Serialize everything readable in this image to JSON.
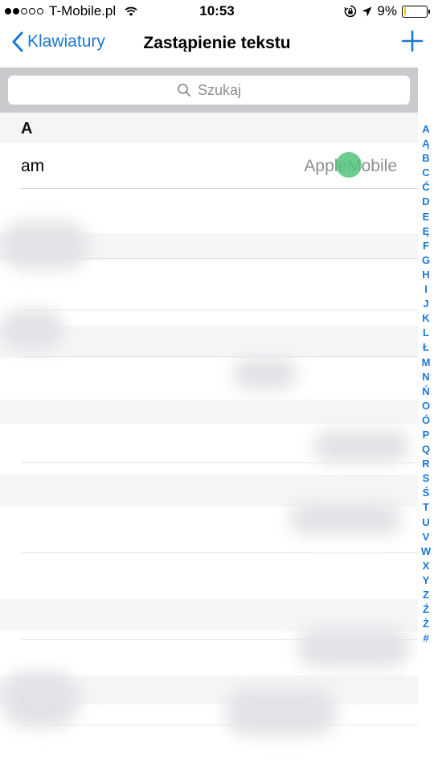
{
  "status_bar": {
    "carrier": "T-Mobile.pl",
    "time": "10:53",
    "battery_percent": "9%",
    "battery_level": 0.09,
    "signal_filled": 2,
    "signal_total": 5,
    "icons": [
      "wifi-icon",
      "rotation-lock-icon",
      "location-icon",
      "battery-icon"
    ]
  },
  "nav": {
    "back_label": "Klawiatury",
    "title": "Zastąpienie tekstu",
    "add_icon": "plus-icon"
  },
  "search": {
    "placeholder": "Szukaj",
    "icon": "search-icon"
  },
  "sections": [
    {
      "header": "A",
      "rows": [
        {
          "shortcut": "am",
          "phrase": "AppleMobile"
        }
      ]
    }
  ],
  "index": [
    "A",
    "Ą",
    "B",
    "C",
    "Ć",
    "D",
    "E",
    "Ę",
    "F",
    "G",
    "H",
    "I",
    "J",
    "K",
    "L",
    "Ł",
    "M",
    "N",
    "Ń",
    "O",
    "Ó",
    "P",
    "Q",
    "R",
    "S",
    "Ś",
    "T",
    "U",
    "V",
    "W",
    "X",
    "Y",
    "Z",
    "Ź",
    "Ż",
    "#"
  ],
  "colors": {
    "accent": "#1a78d6",
    "touch_indicator": "#54c47c",
    "battery_low": "#f2c200"
  }
}
